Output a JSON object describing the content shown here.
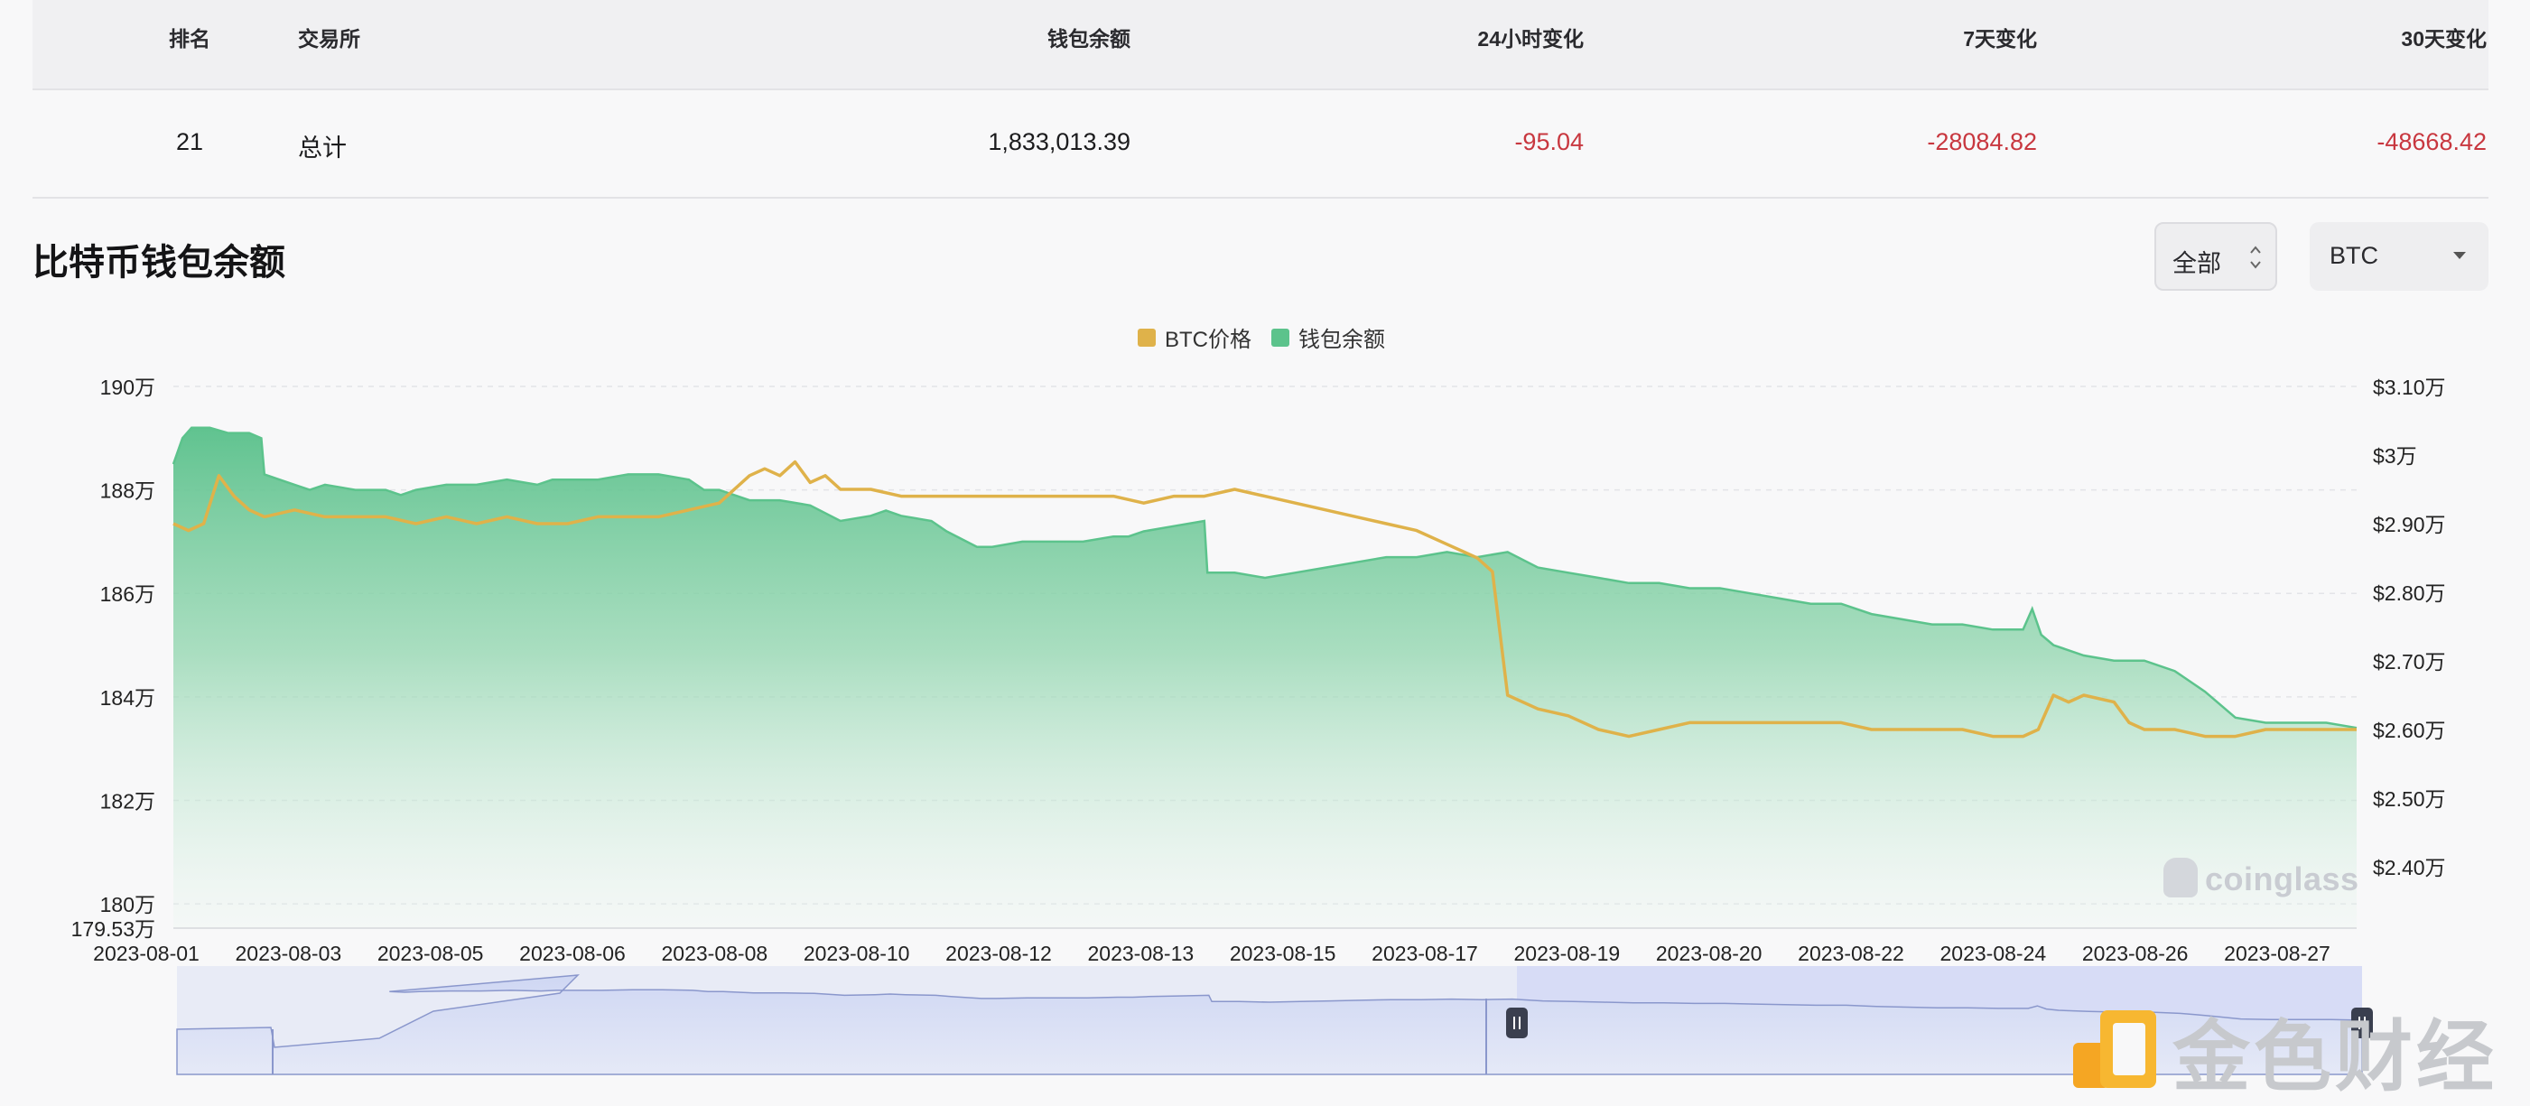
{
  "table": {
    "headers": {
      "rank": "排名",
      "exchange": "交易所",
      "balance": "钱包余额",
      "change_24h": "24小时变化",
      "change_7d": "7天变化",
      "change_30d": "30天变化"
    },
    "row": {
      "rank": "21",
      "exchange": "总计",
      "balance": "1,833,013.39",
      "change_24h": "-95.04",
      "change_7d": "-28084.82",
      "change_30d": "-48668.42"
    }
  },
  "section": {
    "title": "比特币钱包余额",
    "range_label": "全部",
    "unit_label": "BTC"
  },
  "watermark": "coinglass",
  "logo_text": "金色财经",
  "colors": {
    "price": "#dfb24a",
    "balance": "#5cc38c",
    "negative": "#c8373f"
  },
  "chart_data": {
    "type": "area",
    "legend": [
      "BTC价格",
      "钱包余额"
    ],
    "x_ticks": [
      "2023-08-01",
      "2023-08-03",
      "2023-08-05",
      "2023-08-06",
      "2023-08-08",
      "2023-08-10",
      "2023-08-12",
      "2023-08-13",
      "2023-08-15",
      "2023-08-17",
      "2023-08-19",
      "2023-08-20",
      "2023-08-22",
      "2023-08-24",
      "2023-08-26",
      "2023-08-27"
    ],
    "y_left": {
      "ticks": [
        "190万",
        "188万",
        "186万",
        "184万",
        "182万",
        "180万"
      ],
      "values": [
        1900000,
        1880000,
        1860000,
        1840000,
        1820000,
        1800000
      ],
      "min_label": "179.53万",
      "min": 1795300,
      "max": 1900000
    },
    "y_right": {
      "ticks": [
        "$3.10万",
        "$3万",
        "$2.90万",
        "$2.80万",
        "$2.70万",
        "$2.60万",
        "$2.50万",
        "$2.40万"
      ],
      "values": [
        31000,
        30000,
        29000,
        28000,
        27000,
        26000,
        25000,
        24000
      ],
      "min": 24000,
      "max": 31000
    },
    "x_range": [
      0,
      26
    ],
    "series": [
      {
        "name": "钱包余额",
        "axis": "left",
        "points": [
          [
            0,
            1885000
          ],
          [
            0.3,
            1890000
          ],
          [
            0.6,
            1892000
          ],
          [
            1.2,
            1892000
          ],
          [
            1.8,
            1891000
          ],
          [
            2.5,
            1891000
          ],
          [
            2.9,
            1890000
          ],
          [
            3.0,
            1883000
          ],
          [
            3.5,
            1882000
          ],
          [
            4.0,
            1881000
          ],
          [
            4.5,
            1880000
          ],
          [
            5.0,
            1881000
          ],
          [
            6.0,
            1880000
          ],
          [
            7.0,
            1880000
          ],
          [
            7.5,
            1879000
          ],
          [
            8.0,
            1880000
          ],
          [
            9.0,
            1881000
          ],
          [
            10.0,
            1881000
          ],
          [
            11.0,
            1882000
          ],
          [
            12.0,
            1881000
          ],
          [
            12.5,
            1882000
          ],
          [
            13.0,
            1882000
          ],
          [
            14.0,
            1882000
          ],
          [
            15.0,
            1883000
          ],
          [
            16.0,
            1883000
          ],
          [
            17.0,
            1882000
          ],
          [
            17.5,
            1880000
          ],
          [
            18.0,
            1880000
          ],
          [
            19.0,
            1878000
          ],
          [
            20.0,
            1878000
          ],
          [
            21.0,
            1877000
          ],
          [
            22.0,
            1874000
          ],
          [
            23.0,
            1875000
          ],
          [
            23.5,
            1876000
          ],
          [
            24.0,
            1875000
          ],
          [
            25.0,
            1874000
          ],
          [
            25.5,
            1872000
          ],
          [
            26.5,
            1869000
          ],
          [
            27.0,
            1869000
          ],
          [
            28.0,
            1870000
          ],
          [
            29.0,
            1870000
          ],
          [
            30.0,
            1870000
          ],
          [
            31.0,
            1871000
          ],
          [
            31.5,
            1871000
          ],
          [
            32.0,
            1872000
          ],
          [
            33.0,
            1873000
          ],
          [
            34.0,
            1874000
          ],
          [
            34.1,
            1864000
          ],
          [
            35.0,
            1864000
          ],
          [
            36.0,
            1863000
          ],
          [
            37.0,
            1864000
          ],
          [
            38.0,
            1865000
          ],
          [
            39.0,
            1866000
          ],
          [
            40.0,
            1867000
          ],
          [
            41.0,
            1867000
          ],
          [
            42.0,
            1868000
          ],
          [
            43.0,
            1867000
          ],
          [
            44.0,
            1868000
          ],
          [
            45.0,
            1865000
          ],
          [
            46.0,
            1864000
          ],
          [
            47.0,
            1863000
          ],
          [
            48.0,
            1862000
          ],
          [
            49.0,
            1862000
          ],
          [
            50.0,
            1861000
          ],
          [
            51.0,
            1861000
          ],
          [
            52.0,
            1860000
          ],
          [
            53.0,
            1859000
          ],
          [
            54.0,
            1858000
          ],
          [
            55.0,
            1858000
          ],
          [
            56.0,
            1856000
          ],
          [
            57.0,
            1855000
          ],
          [
            58.0,
            1854000
          ],
          [
            59.0,
            1854000
          ],
          [
            60.0,
            1853000
          ],
          [
            61.0,
            1853000
          ],
          [
            61.3,
            1857000
          ],
          [
            61.6,
            1852000
          ],
          [
            62.0,
            1850000
          ],
          [
            63.0,
            1848000
          ],
          [
            64.0,
            1847000
          ],
          [
            65.0,
            1847000
          ],
          [
            66.0,
            1845000
          ],
          [
            66.5,
            1843000
          ],
          [
            67.0,
            1841000
          ],
          [
            68.0,
            1836000
          ],
          [
            69.0,
            1835000
          ],
          [
            70.0,
            1835000
          ],
          [
            71.0,
            1835000
          ],
          [
            72.0,
            1834000
          ]
        ]
      },
      {
        "name": "BTC价格",
        "axis": "right",
        "points": [
          [
            0,
            29000
          ],
          [
            0.5,
            28900
          ],
          [
            1.0,
            29000
          ],
          [
            1.5,
            29700
          ],
          [
            2.0,
            29400
          ],
          [
            2.5,
            29200
          ],
          [
            3.0,
            29100
          ],
          [
            4.0,
            29200
          ],
          [
            5.0,
            29100
          ],
          [
            6.0,
            29100
          ],
          [
            7.0,
            29100
          ],
          [
            8.0,
            29000
          ],
          [
            9.0,
            29100
          ],
          [
            10.0,
            29000
          ],
          [
            11.0,
            29100
          ],
          [
            12.0,
            29000
          ],
          [
            13.0,
            29000
          ],
          [
            14.0,
            29100
          ],
          [
            15.0,
            29100
          ],
          [
            16.0,
            29100
          ],
          [
            17.0,
            29200
          ],
          [
            18.0,
            29300
          ],
          [
            19.0,
            29700
          ],
          [
            19.5,
            29800
          ],
          [
            20.0,
            29700
          ],
          [
            20.5,
            29900
          ],
          [
            21.0,
            29600
          ],
          [
            21.5,
            29700
          ],
          [
            22.0,
            29500
          ],
          [
            23.0,
            29500
          ],
          [
            24.0,
            29400
          ],
          [
            25.0,
            29400
          ],
          [
            26.0,
            29400
          ],
          [
            27.0,
            29400
          ],
          [
            28.0,
            29400
          ],
          [
            29.0,
            29400
          ],
          [
            30.0,
            29400
          ],
          [
            31.0,
            29400
          ],
          [
            32.0,
            29300
          ],
          [
            33.0,
            29400
          ],
          [
            34.0,
            29400
          ],
          [
            35.0,
            29500
          ],
          [
            36.0,
            29400
          ],
          [
            37.0,
            29300
          ],
          [
            38.0,
            29200
          ],
          [
            39.0,
            29100
          ],
          [
            40.0,
            29000
          ],
          [
            41.0,
            28900
          ],
          [
            42.0,
            28700
          ],
          [
            42.5,
            28600
          ],
          [
            43.0,
            28500
          ],
          [
            43.5,
            28300
          ],
          [
            44.0,
            26500
          ],
          [
            45.0,
            26300
          ],
          [
            46.0,
            26200
          ],
          [
            47.0,
            26000
          ],
          [
            48.0,
            25900
          ],
          [
            49.0,
            26000
          ],
          [
            50.0,
            26100
          ],
          [
            51.0,
            26100
          ],
          [
            52.0,
            26100
          ],
          [
            53.0,
            26100
          ],
          [
            54.0,
            26100
          ],
          [
            55.0,
            26100
          ],
          [
            56.0,
            26000
          ],
          [
            57.0,
            26000
          ],
          [
            58.0,
            26000
          ],
          [
            59.0,
            26000
          ],
          [
            60.0,
            25900
          ],
          [
            61.0,
            25900
          ],
          [
            61.5,
            26000
          ],
          [
            62.0,
            26500
          ],
          [
            62.5,
            26400
          ],
          [
            63.0,
            26500
          ],
          [
            64.0,
            26400
          ],
          [
            64.5,
            26100
          ],
          [
            65.0,
            26000
          ],
          [
            66.0,
            26000
          ],
          [
            67.0,
            25900
          ],
          [
            68.0,
            25900
          ],
          [
            69.0,
            26000
          ],
          [
            70.0,
            26000
          ],
          [
            71.0,
            26000
          ],
          [
            72.0,
            26000
          ]
        ]
      }
    ]
  }
}
